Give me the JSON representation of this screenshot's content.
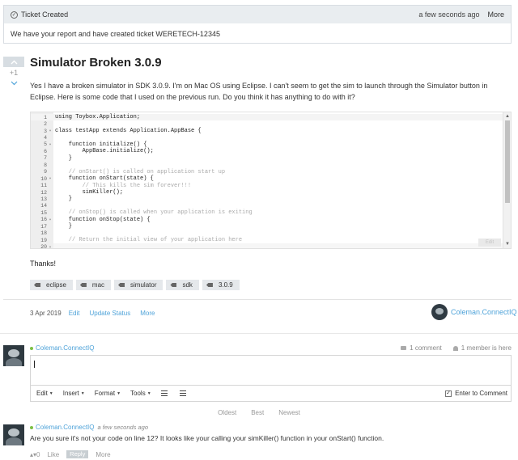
{
  "notice": {
    "title": "Ticket Created",
    "time": "a few seconds ago",
    "more": "More",
    "message": "We have your report and have created ticket WERETECH-12345"
  },
  "question": {
    "votes": "+1",
    "title": "Simulator Broken 3.0.9",
    "body": "Yes I have a broken simulator in SDK 3.0.9. I'm on Mac OS using Eclipse. I can't seem to get the sim to launch through the Simulator button in Eclipse. Here is some code that I used on the previous run. Do you think it has anything to do with it?",
    "code": [
      {
        "n": "1",
        "fold": "",
        "text": "using Toybox.Application;"
      },
      {
        "n": "2",
        "fold": "",
        "text": ""
      },
      {
        "n": "3",
        "fold": "▾",
        "text": "class testApp extends Application.AppBase {"
      },
      {
        "n": "4",
        "fold": "",
        "text": ""
      },
      {
        "n": "5",
        "fold": "▾",
        "text": "    function initialize() {"
      },
      {
        "n": "6",
        "fold": "",
        "text": "        AppBase.initialize();"
      },
      {
        "n": "7",
        "fold": "",
        "text": "    }"
      },
      {
        "n": "8",
        "fold": "",
        "text": ""
      },
      {
        "n": "9",
        "fold": "",
        "text": "    // onStart() is called on application start up"
      },
      {
        "n": "10",
        "fold": "▾",
        "text": "    function onStart(state) {"
      },
      {
        "n": "11",
        "fold": "",
        "text": "        // This kills the sim forever!!!"
      },
      {
        "n": "12",
        "fold": "",
        "text": "        simKiller();"
      },
      {
        "n": "13",
        "fold": "",
        "text": "    }"
      },
      {
        "n": "14",
        "fold": "",
        "text": ""
      },
      {
        "n": "15",
        "fold": "",
        "text": "    // onStop() is called when your application is exiting"
      },
      {
        "n": "16",
        "fold": "▾",
        "text": "    function onStop(state) {"
      },
      {
        "n": "17",
        "fold": "",
        "text": "    }"
      },
      {
        "n": "18",
        "fold": "",
        "text": ""
      },
      {
        "n": "19",
        "fold": "",
        "text": "    // Return the initial view of your application here"
      },
      {
        "n": "20",
        "fold": "▾",
        "text": "    function getInitialView() {"
      }
    ],
    "code_edit_label": "Edit",
    "thanks": "Thanks!",
    "tags": [
      "eclipse",
      "mac",
      "simulator",
      "sdk",
      "3.0.9"
    ],
    "date": "3 Apr 2019",
    "actions": [
      "Edit",
      "Update Status",
      "More"
    ],
    "author": "Coleman.ConnectIQ"
  },
  "composer": {
    "user": "Coleman.ConnectIQ",
    "comment_count": "1 comment",
    "member_count": "1 member is here",
    "toolbar": {
      "edit": "Edit",
      "insert": "Insert",
      "format": "Format",
      "tools": "Tools",
      "enter_label": "Enter to Comment"
    }
  },
  "sort": [
    "Oldest",
    "Best",
    "Newest"
  ],
  "reply": {
    "user": "Coleman.ConnectIQ",
    "when": "a few seconds ago",
    "body": "Are you sure it's not your code on line 12? It looks like your calling your simKiller() function in your onStart() function.",
    "votes": "0",
    "like": "Like",
    "reply": "Reply",
    "more": "More"
  },
  "colors": {
    "link": "#4fa3d9",
    "online": "#7cc046",
    "banner_bg": "#e9edf0"
  }
}
